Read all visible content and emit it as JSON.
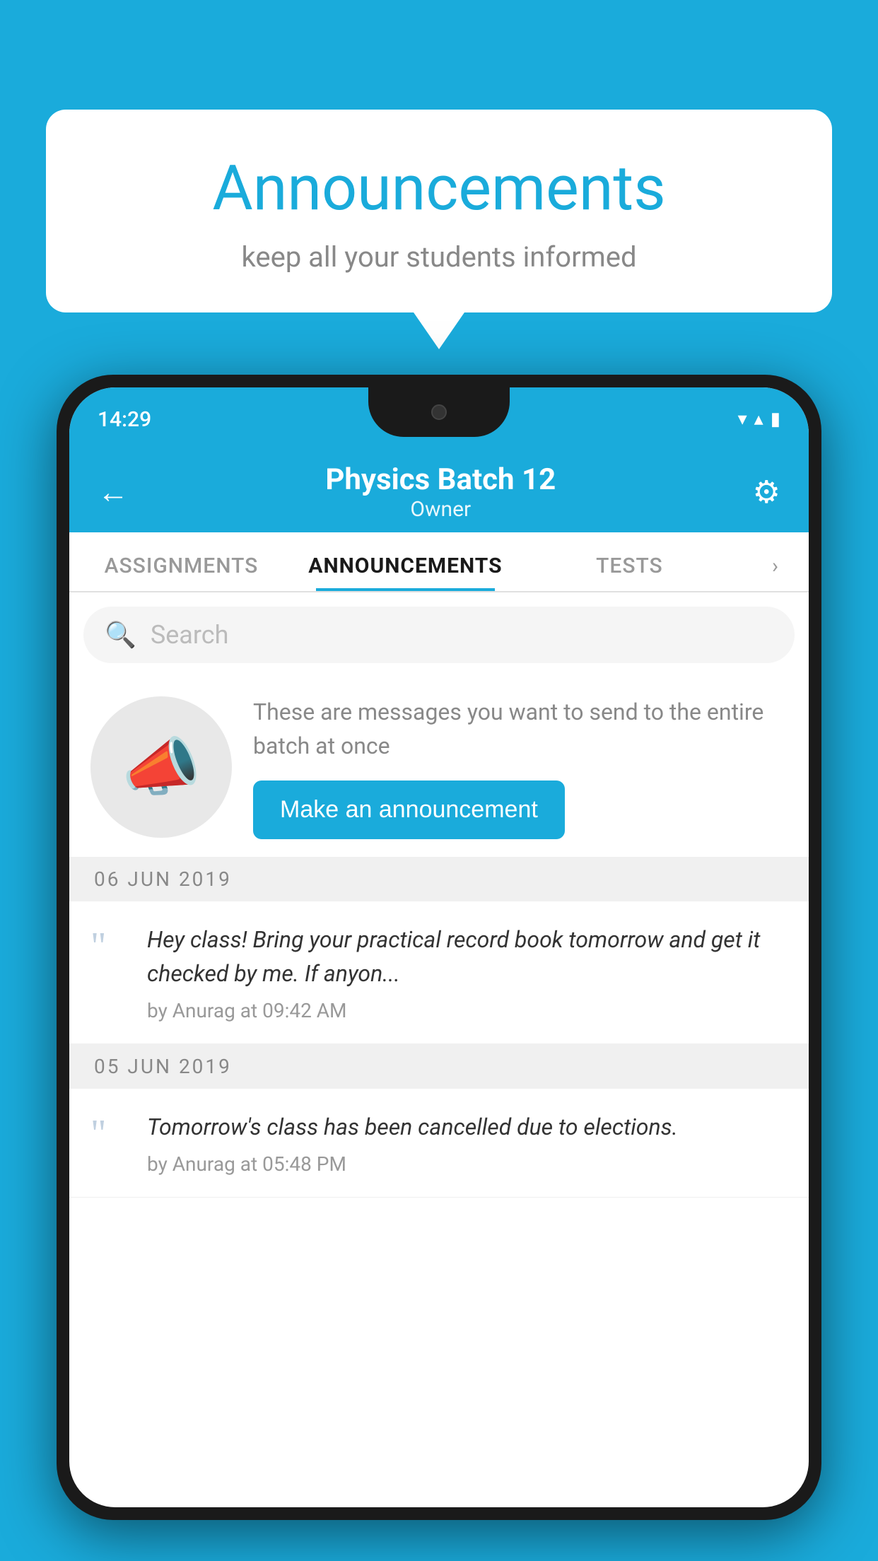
{
  "background_color": "#1AABDB",
  "speech_bubble": {
    "title": "Announcements",
    "subtitle": "keep all your students informed"
  },
  "phone": {
    "status_bar": {
      "time": "14:29",
      "wifi": "▾",
      "signal": "▴",
      "battery": "▮"
    },
    "header": {
      "batch_name": "Physics Batch 12",
      "owner_label": "Owner",
      "back_label": "←",
      "settings_label": "⚙"
    },
    "tabs": [
      {
        "label": "ASSIGNMENTS",
        "active": false
      },
      {
        "label": "ANNOUNCEMENTS",
        "active": true
      },
      {
        "label": "TESTS",
        "active": false
      }
    ],
    "search": {
      "placeholder": "Search"
    },
    "promo": {
      "description": "These are messages you want to send to the entire batch at once",
      "button_label": "Make an announcement"
    },
    "announcements": [
      {
        "date": "06  JUN  2019",
        "text": "Hey class! Bring your practical record book tomorrow and get it checked by me. If anyon...",
        "author": "by Anurag at 09:42 AM"
      },
      {
        "date": "05  JUN  2019",
        "text": "Tomorrow's class has been cancelled due to elections.",
        "author": "by Anurag at 05:48 PM"
      }
    ]
  }
}
